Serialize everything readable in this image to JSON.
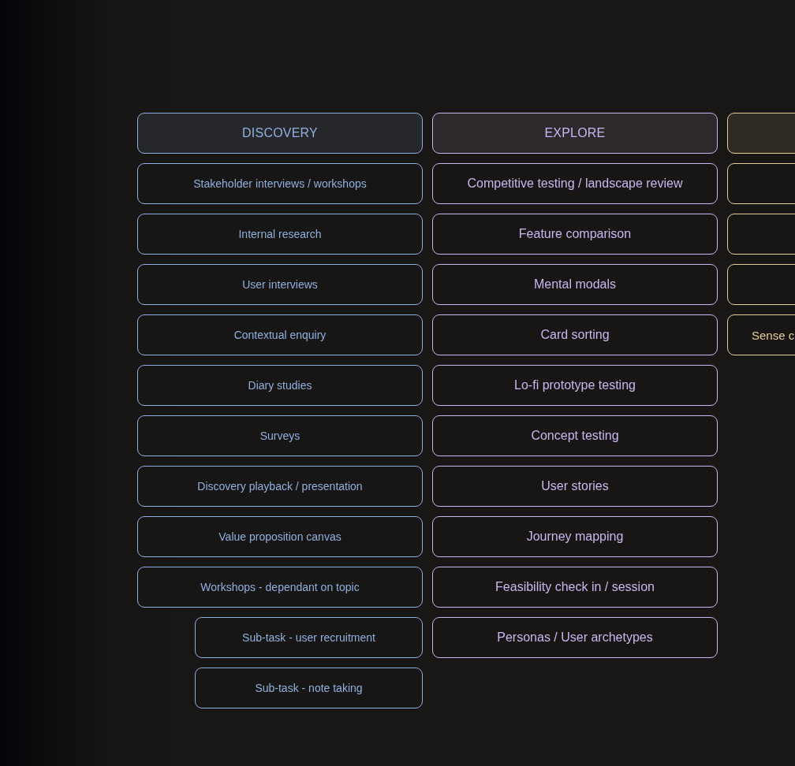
{
  "columns": [
    {
      "kind": "compact",
      "color": "#8fb0e0",
      "header": {
        "kind": "text",
        "label": "DISCOVERY"
      },
      "cards": [
        {
          "kind": "text",
          "text": "Stakeholder interviews / workshops"
        },
        {
          "kind": "text",
          "text": "Internal research"
        },
        {
          "kind": "text",
          "text": "User interviews"
        },
        {
          "kind": "text",
          "text": "Contextual enquiry"
        },
        {
          "kind": "text",
          "text": "Diary studies"
        },
        {
          "kind": "text",
          "text": "Surveys"
        },
        {
          "kind": "text",
          "text": "Discovery playback / presentation"
        },
        {
          "kind": "text",
          "text": "Value proposition canvas"
        },
        {
          "kind": "text",
          "text": "Workshops - dependant on topic",
          "children": [
            {
              "kind": "text",
              "text": "Sub-task - user recruitment"
            },
            {
              "kind": "text",
              "text": "Sub-task - note taking"
            }
          ]
        }
      ]
    },
    {
      "kind": "regular",
      "color": "#c9b6f0",
      "header": {
        "kind": "text",
        "label": "EXPLORE"
      },
      "cards": [
        {
          "kind": "text",
          "text": "Competitive testing / landscape review"
        },
        {
          "kind": "text",
          "text": "Feature comparison"
        },
        {
          "kind": "text",
          "text": "Mental modals"
        },
        {
          "kind": "text",
          "text": "Card sorting"
        },
        {
          "kind": "text",
          "text": "Lo-fi prototype testing"
        },
        {
          "kind": "text",
          "text": "Concept testing"
        },
        {
          "kind": "text",
          "text": "User stories"
        },
        {
          "kind": "text",
          "text": "Journey mapping"
        },
        {
          "kind": "text",
          "text": "Feasibility check in / session"
        },
        {
          "kind": "text",
          "text": "Personas / User archetypes"
        }
      ]
    },
    {
      "kind": "clipped",
      "color": "#e6cd98",
      "header": {
        "kind": "blank"
      },
      "cards": [
        {
          "kind": "blank"
        },
        {
          "kind": "blank"
        },
        {
          "kind": "blank"
        },
        {
          "kind": "text",
          "text": "Sense c"
        }
      ]
    }
  ]
}
